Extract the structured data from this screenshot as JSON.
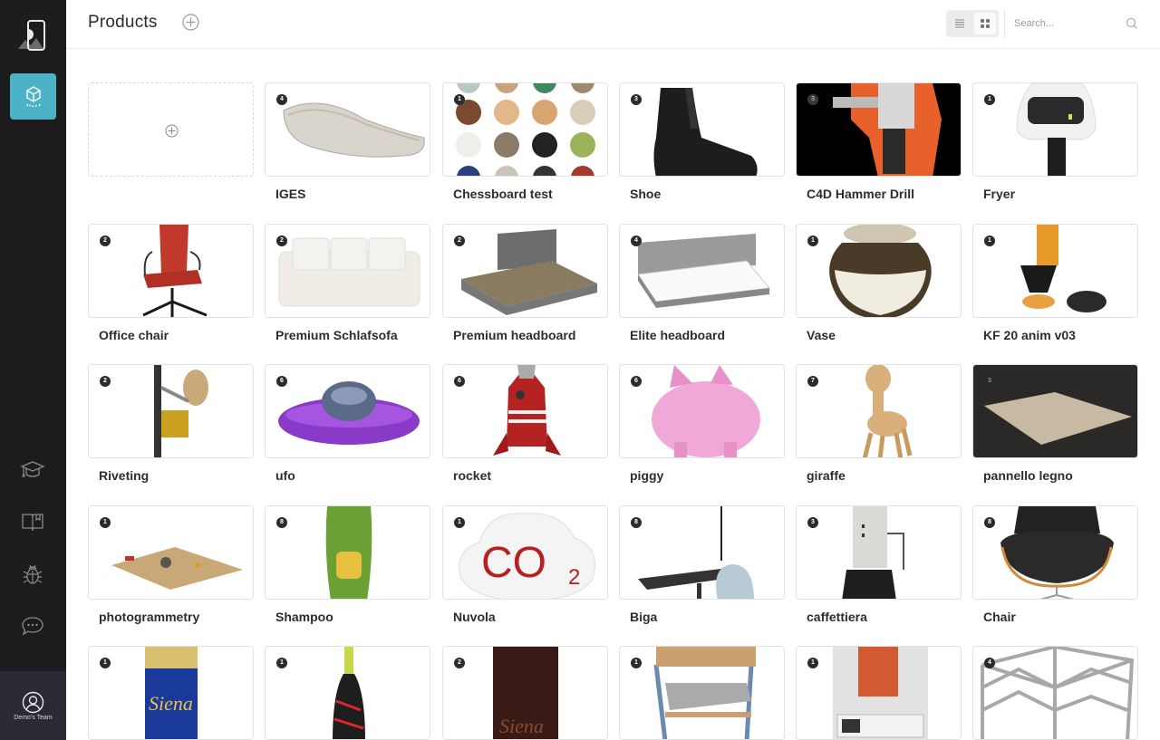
{
  "app": {
    "page_title": "Products",
    "team_label": "Demo's Team"
  },
  "sidebar": {
    "items": [
      {
        "name": "products",
        "icon": "cube-icon",
        "active": true
      },
      {
        "name": "academy",
        "icon": "graduation-cap-icon"
      },
      {
        "name": "documentation",
        "icon": "book-icon"
      },
      {
        "name": "report-bug",
        "icon": "bug-icon"
      },
      {
        "name": "chat",
        "icon": "chat-icon"
      }
    ]
  },
  "toolbar": {
    "search_placeholder": "Search...",
    "search_value": "",
    "view_modes": [
      "list",
      "grid"
    ],
    "active_view": "grid"
  },
  "colors": {
    "accent": "#4bb3c5",
    "sidebar_bg": "#1c1c1f",
    "team_bg": "#2b2a35"
  },
  "products": [
    {
      "name": "IGES",
      "count": "4"
    },
    {
      "name": "Chessboard test",
      "count": "1"
    },
    {
      "name": "Shoe",
      "count": "3"
    },
    {
      "name": "C4D Hammer Drill",
      "count": "3"
    },
    {
      "name": "Fryer",
      "count": "1"
    },
    {
      "name": "Office chair",
      "count": "2"
    },
    {
      "name": "Premium Schlafsofa",
      "count": "2"
    },
    {
      "name": "Premium headboard",
      "count": "2"
    },
    {
      "name": "Elite headboard",
      "count": "4"
    },
    {
      "name": "Vase",
      "count": "1"
    },
    {
      "name": "KF 20 anim v03",
      "count": "1"
    },
    {
      "name": "Riveting",
      "count": "2"
    },
    {
      "name": "ufo",
      "count": "6"
    },
    {
      "name": "rocket",
      "count": "6"
    },
    {
      "name": "piggy",
      "count": "6"
    },
    {
      "name": "giraffe",
      "count": "7"
    },
    {
      "name": "pannello legno",
      "count": "3"
    },
    {
      "name": "photogrammetry",
      "count": "1"
    },
    {
      "name": "Shampoo",
      "count": "8"
    },
    {
      "name": "Nuvola",
      "count": "1"
    },
    {
      "name": "Biga",
      "count": "8"
    },
    {
      "name": "caffettiera",
      "count": "3"
    },
    {
      "name": "Chair",
      "count": "8"
    },
    {
      "name": "",
      "count": "1"
    },
    {
      "name": "",
      "count": "1"
    },
    {
      "name": "",
      "count": "2"
    },
    {
      "name": "",
      "count": "1"
    },
    {
      "name": "",
      "count": "1"
    },
    {
      "name": "",
      "count": "4"
    }
  ]
}
